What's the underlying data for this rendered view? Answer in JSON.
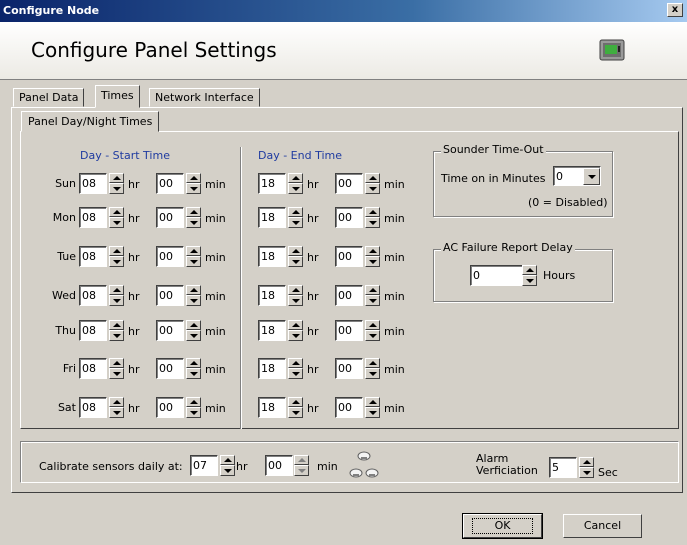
{
  "window": {
    "title": "Configure Node",
    "close_label": "x"
  },
  "header": {
    "title": "Configure Panel Settings"
  },
  "tabs": [
    {
      "label": "Panel Data",
      "active": false
    },
    {
      "label": "Times",
      "active": true
    },
    {
      "label": "Network Interface",
      "active": false
    }
  ],
  "subtab": {
    "label": "Panel Day/Night Times"
  },
  "schedule": {
    "start_title": "Day - Start Time",
    "end_title": "Day - End Time",
    "hr_label": "hr",
    "min_label": "min",
    "days": [
      {
        "day": "Sun",
        "start_hr": "08",
        "start_min": "00",
        "end_hr": "18",
        "end_min": "00"
      },
      {
        "day": "Mon",
        "start_hr": "08",
        "start_min": "00",
        "end_hr": "18",
        "end_min": "00"
      },
      {
        "day": "Tue",
        "start_hr": "08",
        "start_min": "00",
        "end_hr": "18",
        "end_min": "00"
      },
      {
        "day": "Wed",
        "start_hr": "08",
        "start_min": "00",
        "end_hr": "18",
        "end_min": "00"
      },
      {
        "day": "Thu",
        "start_hr": "08",
        "start_min": "00",
        "end_hr": "18",
        "end_min": "00"
      },
      {
        "day": "Fri",
        "start_hr": "08",
        "start_min": "00",
        "end_hr": "18",
        "end_min": "00"
      },
      {
        "day": "Sat",
        "start_hr": "08",
        "start_min": "00",
        "end_hr": "18",
        "end_min": "00"
      }
    ]
  },
  "sounder": {
    "title": "Sounder Time-Out",
    "label": "Time on in Minutes",
    "value": "0",
    "note": "(0 = Disabled)"
  },
  "ac_failure": {
    "title": "AC Failure Report Delay",
    "value": "0",
    "unit": "Hours"
  },
  "calibrate": {
    "label": "Calibrate sensors daily at:",
    "hr_value": "07",
    "hr_label": "hr",
    "min_value": "00",
    "min_label": "min"
  },
  "alarm": {
    "label_line1": "Alarm",
    "label_line2": "Verficiation",
    "value": "5",
    "unit": "Sec"
  },
  "buttons": {
    "ok": "OK",
    "cancel": "Cancel"
  },
  "icons": {
    "panel": "control-panel-icon",
    "sensors": "smoke-detectors-icon"
  }
}
